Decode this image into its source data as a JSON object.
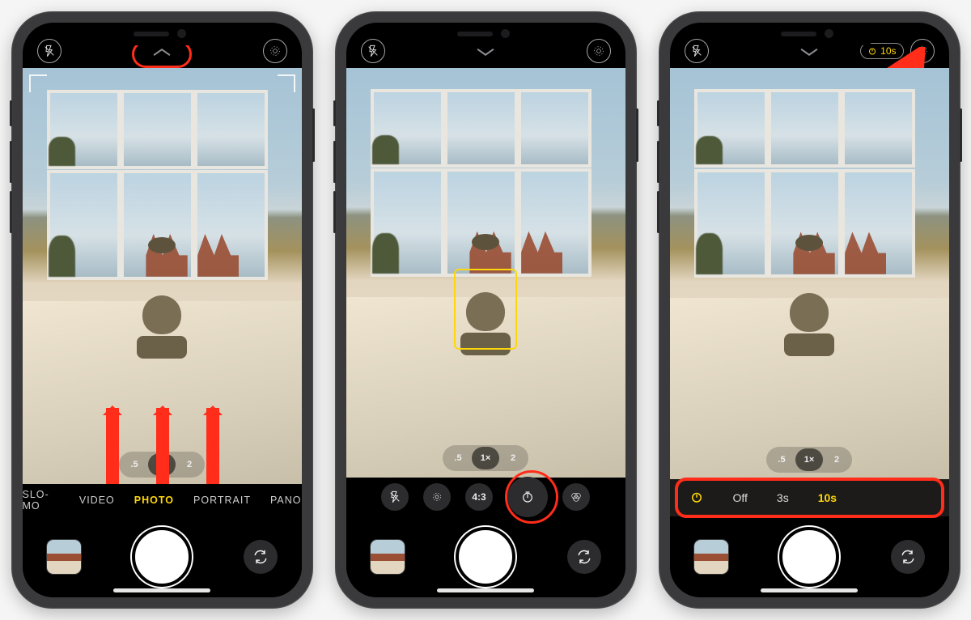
{
  "zoom": {
    "out": ".5",
    "one": "1×",
    "two": "2"
  },
  "modes": {
    "slomo": "SLO-MO",
    "video": "VIDEO",
    "photo": "PHOTO",
    "portrait": "PORTRAIT",
    "pano": "PANO"
  },
  "aspect_label": "4:3",
  "timer": {
    "badge": "10s",
    "off": "Off",
    "three": "3s",
    "ten": "10s"
  }
}
